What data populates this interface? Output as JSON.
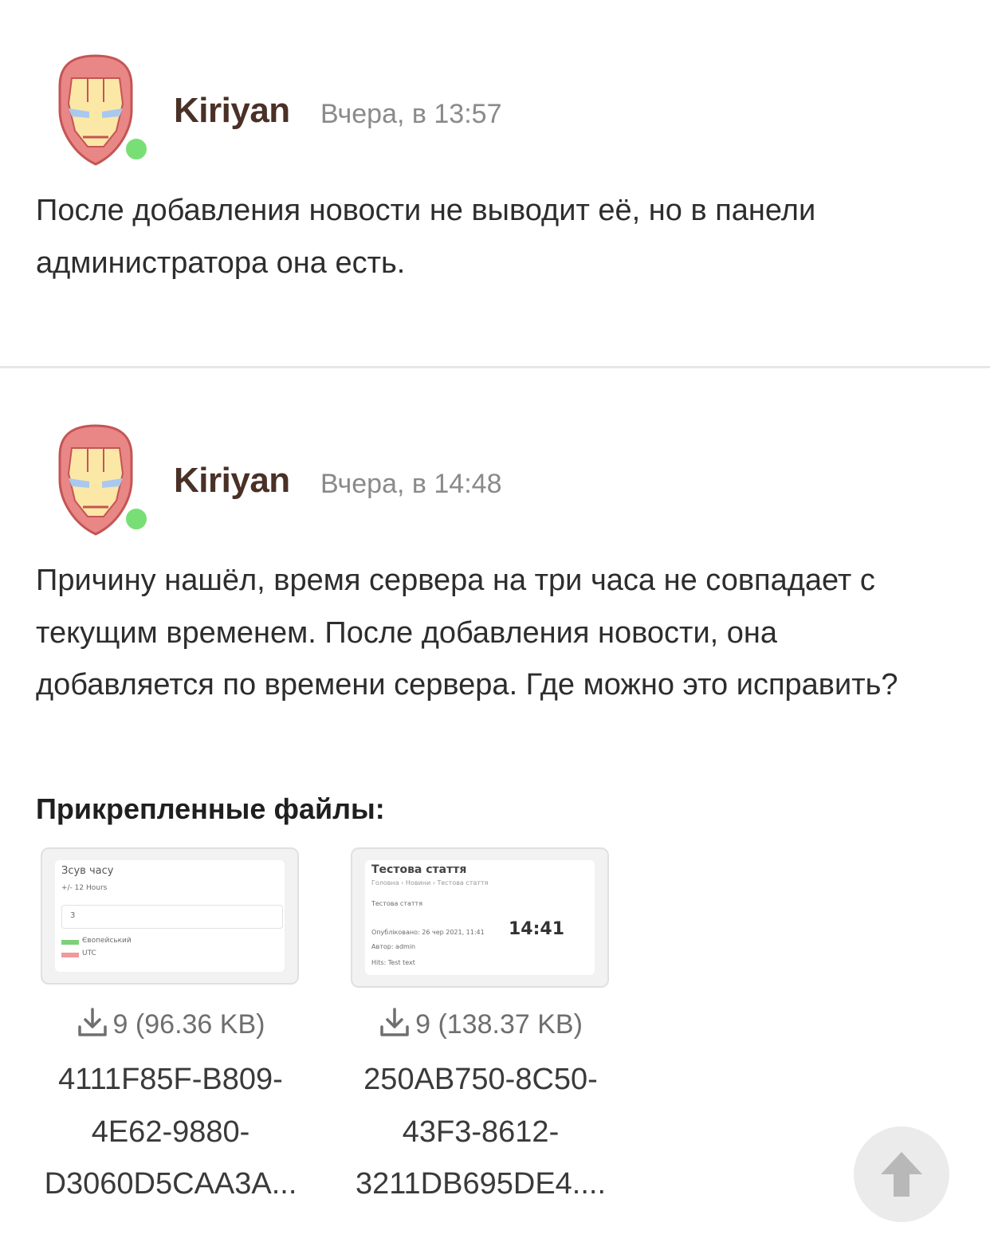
{
  "posts": [
    {
      "author": "Kiriyan",
      "time": "Вчера, в 13:57",
      "avatar_icon": "iron-man-avatar-icon",
      "online": true,
      "text": "После добавления новости не выводит её, но в панели администратора она есть."
    },
    {
      "author": "Kiriyan",
      "time": "Вчера, в 14:48",
      "avatar_icon": "iron-man-avatar-icon",
      "online": true,
      "text": "Причину нашёл, время сервера на три часа не совпадает с текущим временем. После добавления новости, она добавляется по времени сервера. Где можно это исправить?",
      "attachments_title": "Прикрепленные файлы:",
      "attachments": [
        {
          "downloads": "9",
          "size": "(96.36 KB)",
          "filename_lines": [
            "4111F85F-B809-",
            "4E62-9880-",
            "D3060D5CAA3A..."
          ],
          "thumb": {
            "heading": "Зсув часу",
            "sub": "+/- 12 Hours",
            "input_value": "3",
            "row1": "Євопейський",
            "row2": "UTC"
          }
        },
        {
          "downloads": "9",
          "size": "(138.37 KB)",
          "filename_lines": [
            "250AB750-8C50-",
            "43F3-8612-",
            "3211DB695DE4...."
          ],
          "thumb": {
            "heading": "Тестова стаття",
            "breadcrumb": "Головна › Новини › Тестова стаття",
            "line1": "Тестова стаття",
            "line2": "Опубліковано: 26 чер 2021, 11:41",
            "big_time": "14:41",
            "line3": "Автор: admin",
            "line4": "Hits: Test text"
          }
        }
      ]
    }
  ],
  "scroll_top_icon": "arrow-up-icon",
  "colors": {
    "author": "#4a3026",
    "online": "#78df76",
    "divider": "#e6e6ea"
  }
}
